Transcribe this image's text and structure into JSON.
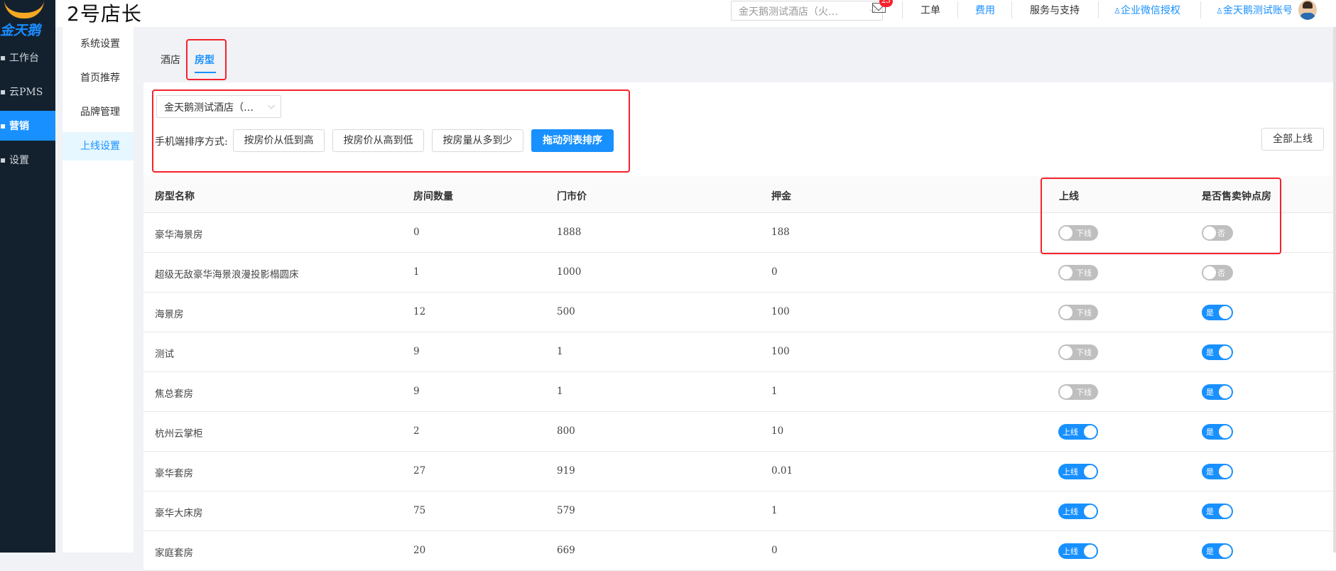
{
  "app": {
    "brand": "2号店长",
    "logo_text": "金天鹅"
  },
  "sidebar": {
    "items": [
      {
        "label": "工作台"
      },
      {
        "label": "云PMS"
      },
      {
        "label": "营销"
      },
      {
        "label": "设置"
      }
    ]
  },
  "header": {
    "hotel_select": "金天鹅测试酒店（火…",
    "mail_badge": "23",
    "links": [
      "工单",
      "费用",
      "服务与支持",
      "企业微信授权",
      "金天鹅测试账号"
    ]
  },
  "submenu": {
    "items": [
      "系统设置",
      "首页推荐",
      "品牌管理",
      "上线设置"
    ]
  },
  "tabs": [
    "酒店",
    "房型"
  ],
  "controls": {
    "hotel_select": "金天鹅测试酒店（…",
    "sort_label": "手机端排序方式:",
    "sort_buttons": [
      "按房价从低到高",
      "按房价从高到低",
      "按房量从多到少",
      "拖动列表排序"
    ],
    "all_online": "全部上线"
  },
  "table": {
    "headers": [
      "房型名称",
      "房间数量",
      "门市价",
      "押金",
      "上线",
      "是否售卖钟点房"
    ],
    "switch_labels": {
      "online": "上线",
      "offline": "下线",
      "yes": "是",
      "no": "否"
    },
    "rows": [
      {
        "name": "豪华海景房",
        "count": "0",
        "price": "1888",
        "deposit": "188",
        "online": false,
        "hourly": false
      },
      {
        "name": "超级无敌豪华海景浪漫投影榻圆床",
        "count": "1",
        "price": "1000",
        "deposit": "0",
        "online": false,
        "hourly": false
      },
      {
        "name": "海景房",
        "count": "12",
        "price": "500",
        "deposit": "100",
        "online": false,
        "hourly": true
      },
      {
        "name": "测试",
        "count": "9",
        "price": "1",
        "deposit": "100",
        "online": false,
        "hourly": true
      },
      {
        "name": "焦总套房",
        "count": "9",
        "price": "1",
        "deposit": "1",
        "online": false,
        "hourly": true
      },
      {
        "name": "杭州云掌柜",
        "count": "2",
        "price": "800",
        "deposit": "10",
        "online": true,
        "hourly": true
      },
      {
        "name": "豪华套房",
        "count": "27",
        "price": "919",
        "deposit": "0.01",
        "online": true,
        "hourly": true
      },
      {
        "name": "豪华大床房",
        "count": "75",
        "price": "579",
        "deposit": "1",
        "online": true,
        "hourly": true
      },
      {
        "name": "家庭套房",
        "count": "20",
        "price": "669",
        "deposit": "0",
        "online": true,
        "hourly": true
      }
    ]
  }
}
